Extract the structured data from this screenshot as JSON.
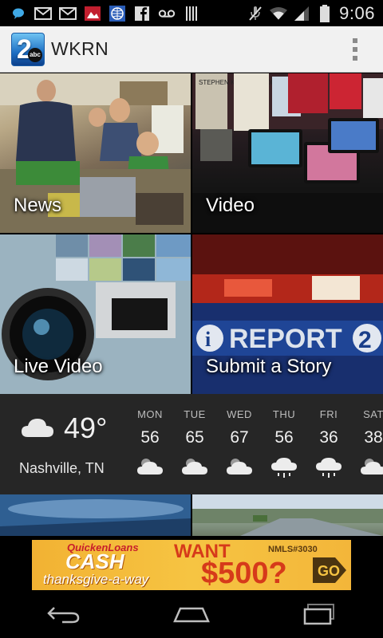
{
  "status_bar": {
    "time": "9:06",
    "left_icons": [
      "chat-icon",
      "gmail-icon",
      "gmail-icon",
      "photo-icon",
      "globe-icon",
      "facebook-icon",
      "voicemail-icon",
      "barcode-icon"
    ],
    "right_icons": [
      "mute-icon",
      "wifi-icon",
      "signal-icon",
      "battery-icon"
    ]
  },
  "action_bar": {
    "logo_number": "2",
    "logo_badge": "abc",
    "title": "WKRN",
    "overflow_icon": "overflow-menu-icon"
  },
  "tiles": [
    {
      "label": "News"
    },
    {
      "label": "Video"
    },
    {
      "label": "Live Video"
    },
    {
      "label": "Submit a Story"
    }
  ],
  "tile_art_text": {
    "report": "REPORT",
    "report_num": "2",
    "book": "STEPHEN KING DOCTOR"
  },
  "weather": {
    "current_temp": "49°",
    "location": "Nashville, TN",
    "current_icon": "cloud-icon",
    "forecast": [
      {
        "day": "MON",
        "temp": "56",
        "icon": "partly-cloudy-icon"
      },
      {
        "day": "TUE",
        "temp": "65",
        "icon": "partly-cloudy-icon"
      },
      {
        "day": "WED",
        "temp": "67",
        "icon": "partly-cloudy-icon"
      },
      {
        "day": "THU",
        "temp": "56",
        "icon": "rain-icon"
      },
      {
        "day": "FRI",
        "temp": "36",
        "icon": "rain-icon"
      },
      {
        "day": "SAT",
        "temp": "38",
        "icon": "partly-cloudy-icon"
      }
    ]
  },
  "ad": {
    "brand": "QuickenLoans",
    "cash": "CASH",
    "tagline": "thanksgive-a-way",
    "want": "WANT",
    "amount": "$500?",
    "nmls": "NMLS#3030",
    "go": "GO"
  },
  "nav_bar": {
    "buttons": [
      "back-icon",
      "home-icon",
      "recent-apps-icon"
    ]
  },
  "colors": {
    "action_bar_bg": "#f1f1f1",
    "weather_bg": "#262626",
    "ad_bg": "#f6c442"
  }
}
